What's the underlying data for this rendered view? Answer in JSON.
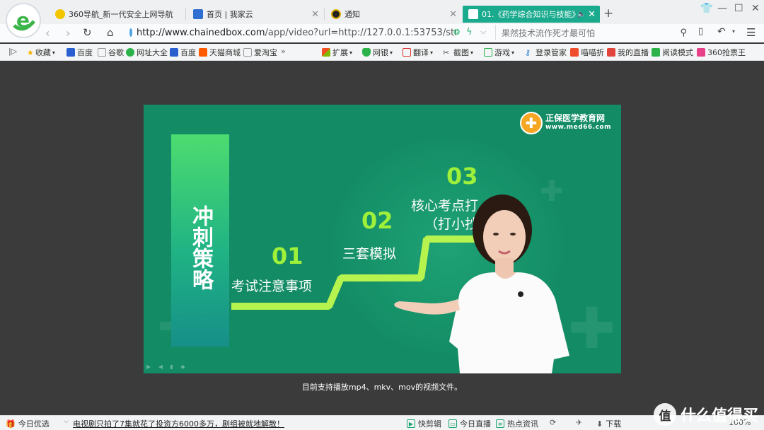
{
  "browser": {
    "logo_letter": "e",
    "tabs": [
      {
        "label": "360导航_新一代安全上网导航",
        "active": false
      },
      {
        "label": "首页 | 我家云",
        "active": false
      },
      {
        "label": "通知",
        "active": false
      },
      {
        "label": "01.《药学综合知识与技能》",
        "active": true
      }
    ],
    "new_tab_symbol": "+",
    "address": {
      "url_host": "http://www.chainedbox.com",
      "url_rest": "/app/video?url=http://127.0.0.1:53753/str",
      "search_placeholder": "果然技术流作死才最可怕"
    },
    "bookmarks": {
      "left": [
        {
          "label": "收藏",
          "icon": "star-icon"
        },
        {
          "label": "百度",
          "icon": "baidu-paw-icon"
        },
        {
          "label": "谷歌",
          "icon": "page-icon"
        },
        {
          "label": "网址大全",
          "icon": "360-icon"
        },
        {
          "label": "百度",
          "icon": "baidu-paw-icon"
        },
        {
          "label": "天猫商城",
          "icon": "tmall-icon"
        },
        {
          "label": "爱淘宝",
          "icon": "page-icon"
        }
      ],
      "overflow": "»",
      "right": [
        {
          "label": "扩展",
          "icon": "extension-icon"
        },
        {
          "label": "网银",
          "icon": "shield-icon"
        },
        {
          "label": "翻译",
          "icon": "translate-icon"
        },
        {
          "label": "截图",
          "icon": "scissors-icon"
        },
        {
          "label": "游戏",
          "icon": "game-icon"
        },
        {
          "label": "登录管家",
          "icon": "key-icon"
        },
        {
          "label": "喵喵折",
          "icon": "discount-icon"
        },
        {
          "label": "我的直播",
          "icon": "live-icon"
        },
        {
          "label": "阅读模式",
          "icon": "book-icon"
        },
        {
          "label": "360抢票王",
          "icon": "ticket-icon"
        }
      ]
    }
  },
  "video": {
    "banner_text": "冲刺策略",
    "logo_name": "正保医学教育网",
    "logo_url": "www.med66.com",
    "steps": [
      {
        "num": "01",
        "label": "考试注意事项"
      },
      {
        "num": "02",
        "label": "三套模拟"
      },
      {
        "num": "03",
        "label": "核心考点打",
        "label2": "（打小抄"
      }
    ],
    "support_text": "目前支持播放mp4、mkv、mov的视频文件。"
  },
  "statusbar": {
    "today_pick": "今日优选",
    "news": "电视剧只拍了7集就花了投资方6000多万，剧组被就地解散！",
    "items": [
      "快剪辑",
      "今日直播",
      "热点资讯"
    ],
    "download": "下载",
    "zoom": "100%",
    "watermark": "什么值得买",
    "watermark_glyph": "值"
  },
  "colors": {
    "accent": "#1aaa8e",
    "video_bg": "#138c65",
    "step_number": "#9ff03a",
    "page_bg": "#3b3b3b"
  }
}
